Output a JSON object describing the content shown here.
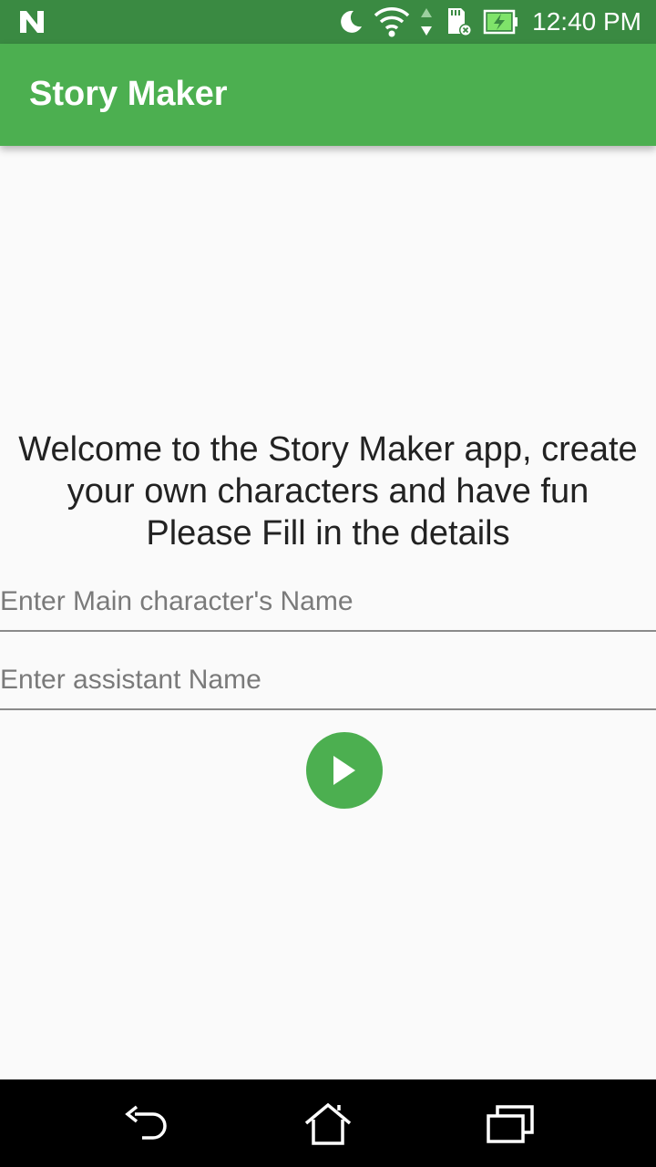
{
  "status_bar": {
    "time": "12:40 PM",
    "icons": [
      "n-logo-icon",
      "moon-icon",
      "wifi-icon",
      "data-arrows-icon",
      "sd-card-icon",
      "battery-charging-icon"
    ]
  },
  "app_bar": {
    "title": "Story Maker"
  },
  "main": {
    "welcome_lines": [
      "Welcome to the Story Maker app, create",
      "your own characters and have fun",
      "Please Fill in the details"
    ],
    "main_character_field": {
      "value": "",
      "placeholder": "Enter Main character's Name"
    },
    "assistant_field": {
      "value": "",
      "placeholder": "Enter assistant Name"
    },
    "play_button_icon": "play-icon"
  },
  "nav_bar": {
    "icons": [
      "back-icon",
      "home-icon",
      "recent-apps-icon"
    ]
  },
  "colors": {
    "status_bar": "#3a8a42",
    "app_bar": "#4caf50",
    "accent": "#4caf50",
    "background": "#fafafa",
    "nav_bar": "#000000"
  }
}
